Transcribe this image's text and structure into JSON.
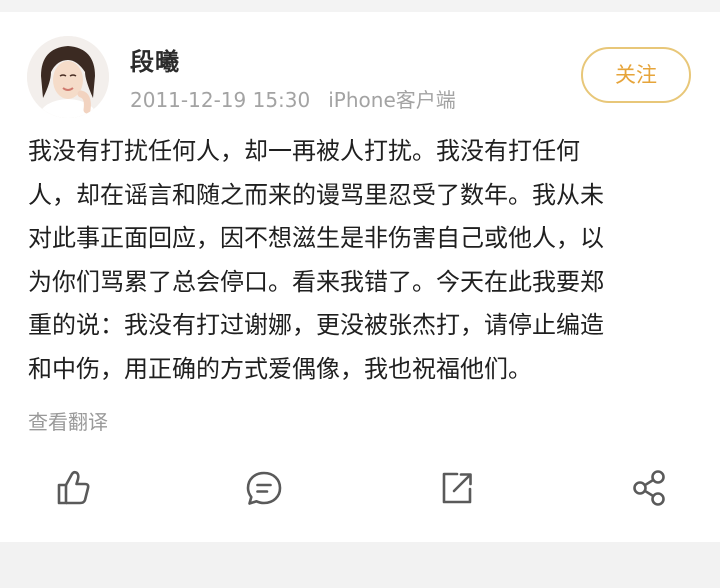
{
  "post": {
    "author": "段曦",
    "time": "2011-12-19 15:30",
    "source": "iPhone客户端",
    "follow_label": "关注",
    "lines": [
      "我没有打扰任何人，却一再被人打扰。我没有打任何",
      "人，却在谣言和随之而来的谩骂里忍受了数年。我从未",
      "对此事正面回应，因不想滋生是非伤害自己或他人，以",
      "为你们骂累了总会停口。看来我错了。今天在此我要郑",
      "重的说：我没有打过谢娜，更没被张杰打，请停止编造",
      "和中伤，用正确的方式爱偶像，我也祝福他们。"
    ],
    "translate_label": "查看翻译"
  },
  "actions": [
    {
      "icon": "like-icon"
    },
    {
      "icon": "comment-icon"
    },
    {
      "icon": "repost-icon"
    },
    {
      "icon": "share-icon"
    }
  ],
  "colors": {
    "follow_accent": "#e6a43a",
    "follow_border": "#e8c779",
    "meta_text": "#a3a3a3",
    "body_text": "#1f1f1f",
    "icon_stroke": "#5a5a5a"
  }
}
